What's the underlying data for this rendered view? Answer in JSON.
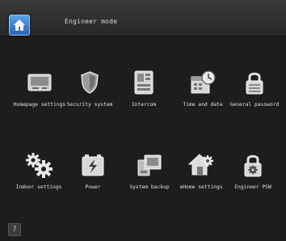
{
  "header": {
    "title": "Engineer mode",
    "home_icon": "home-icon"
  },
  "tiles": [
    {
      "label": "Homepage settings",
      "icon": "monitor-icon"
    },
    {
      "label": "Security system",
      "icon": "shield-icon"
    },
    {
      "label": "Intercom",
      "icon": "intercom-icon"
    },
    {
      "label": "Time and date",
      "icon": "calendar-clock-icon"
    },
    {
      "label": "General password",
      "icon": "lock-icon"
    },
    {
      "label": "Indoor settings",
      "icon": "gears-icon"
    },
    {
      "label": "Power",
      "icon": "battery-icon"
    },
    {
      "label": "System backup",
      "icon": "backup-icon"
    },
    {
      "label": "eHome settings",
      "icon": "house-gear-icon"
    },
    {
      "label": "Engineer PSW",
      "icon": "lock-gear-icon"
    }
  ],
  "footer": {
    "help_label": "?"
  }
}
